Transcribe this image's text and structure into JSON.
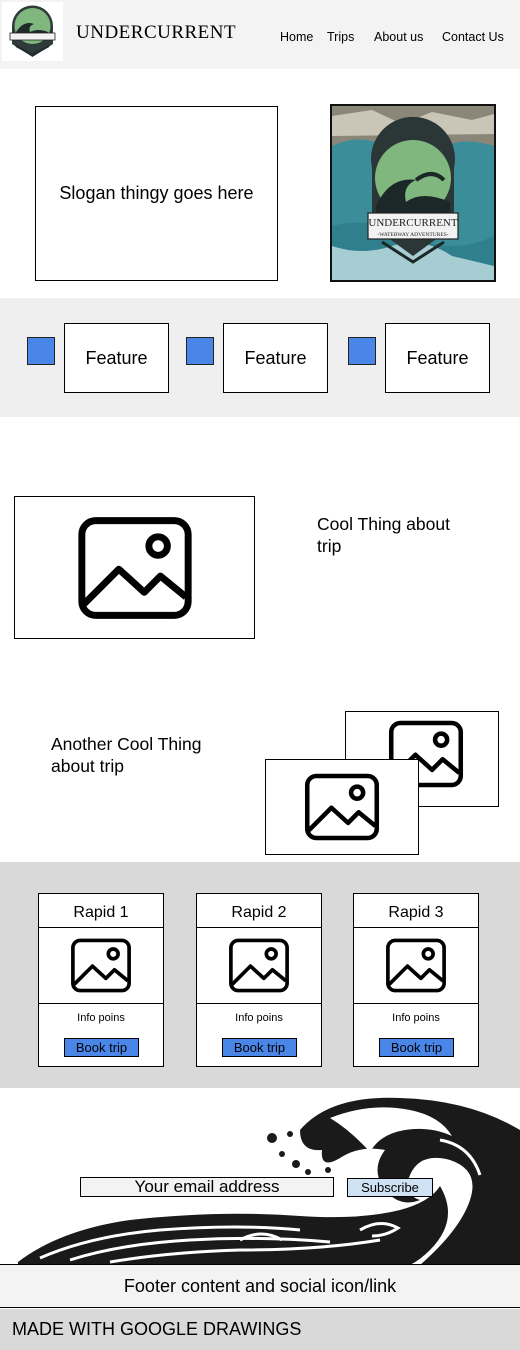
{
  "header": {
    "brand": "UNDERCURRENT",
    "nav": [
      "Home",
      "Trips",
      "About us",
      "Contact Us"
    ]
  },
  "hero": {
    "slogan": "Slogan thingy goes here",
    "photo_brand": "UNDERCURRENT",
    "photo_tagline": "-WATERWAY ADVENTURES-"
  },
  "features": [
    "Feature",
    "Feature",
    "Feature"
  ],
  "cool_things": [
    "Cool Thing about trip",
    "Another Cool Thing about trip"
  ],
  "rapids": [
    {
      "title": "Rapid 1",
      "info": "Info poins",
      "book": "Book trip"
    },
    {
      "title": "Rapid 2",
      "info": "Info poins",
      "book": "Book trip"
    },
    {
      "title": "Rapid 3",
      "info": "Info poins",
      "book": "Book trip"
    }
  ],
  "newsletter": {
    "email_placeholder": "Your email address",
    "subscribe": "Subscribe"
  },
  "footer": {
    "content": "Footer content and social icon/link",
    "made_with": "MADE WITH GOOGLE DRAWINGS"
  },
  "colors": {
    "accent_blue": "#4a86e8",
    "subscribe_bg": "#cfe2f3",
    "logo_green": "#7fb77e"
  }
}
